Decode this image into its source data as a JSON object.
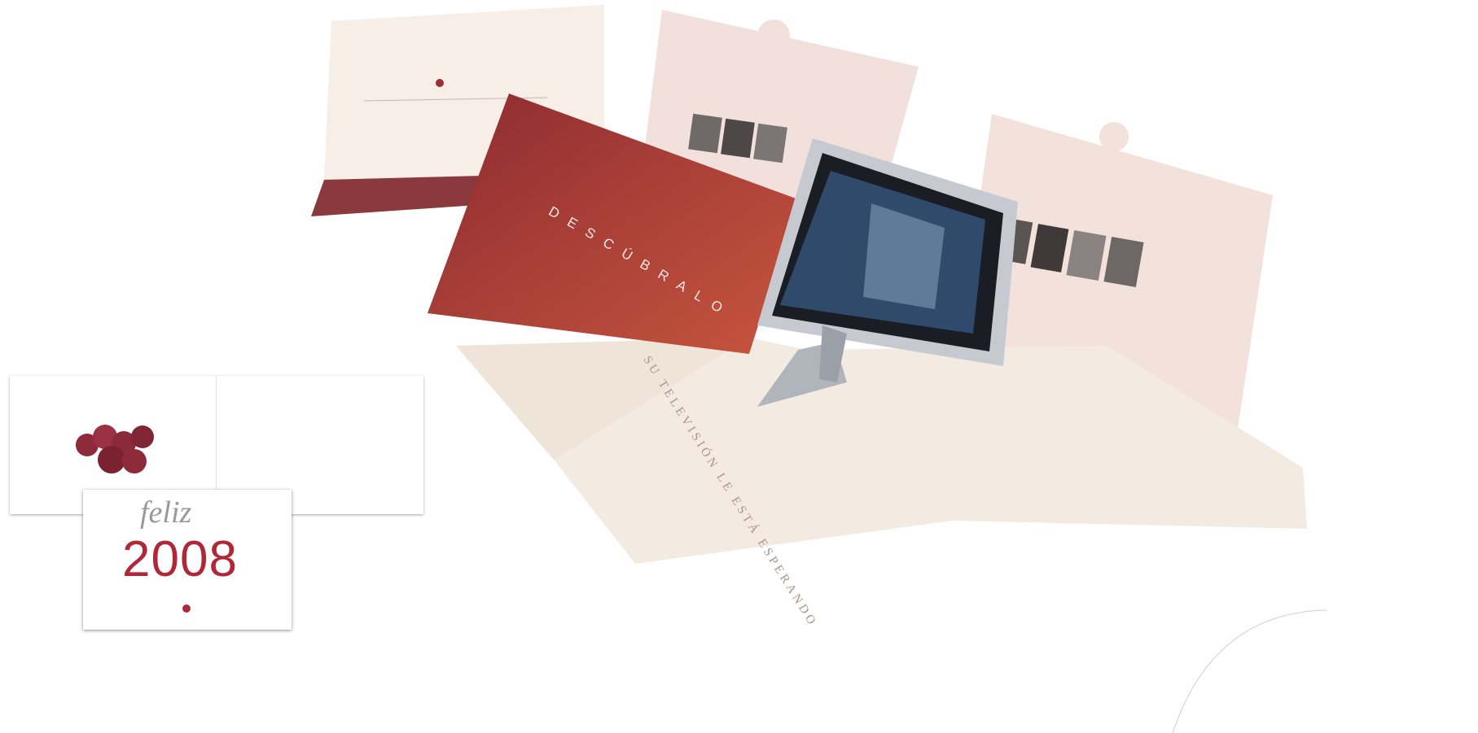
{
  "image": {
    "description": "Photograph of printed Christmas mailer pieces with a pop-up TV and a 2008 greeting card",
    "colors": {
      "wine": "#8d2b31",
      "red_cover": "#b6423e",
      "cream": "#f4ece4",
      "screen_dark": "#1a1d24"
    }
  },
  "mailer": {
    "cover_word": "DESCÚBRALO",
    "inner_headline": "SU TELEVISIÓN LE ESTÁ ESPERANDO"
  },
  "greeting_card": {
    "feliz": "feliz",
    "year": "2008"
  }
}
